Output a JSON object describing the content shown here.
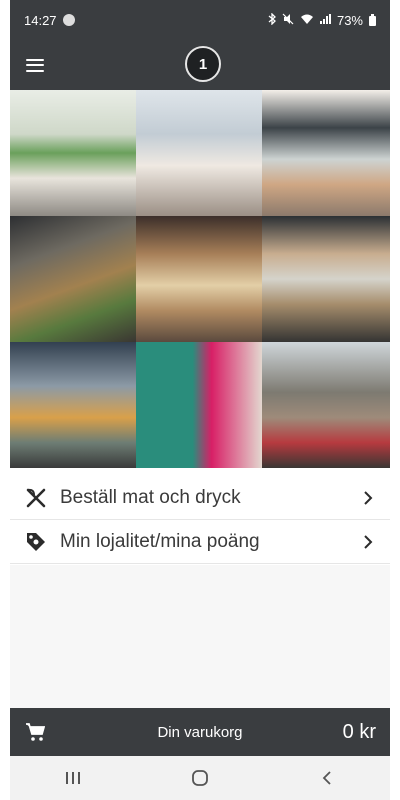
{
  "status_bar": {
    "time": "14:27",
    "battery": "73%",
    "icons": [
      "spotify-icon",
      "bluetooth-icon",
      "mute-icon",
      "wifi-icon",
      "signal-icon",
      "battery-icon"
    ]
  },
  "app_bar": {
    "logo_text": "1"
  },
  "photo_grid": {
    "tiles": [
      "photo-1",
      "photo-2",
      "photo-3",
      "photo-4",
      "photo-5",
      "photo-6",
      "photo-7",
      "photo-8",
      "photo-9"
    ]
  },
  "menu": {
    "items": [
      {
        "label": "Beställ mat och dryck",
        "icon": "cutlery-icon"
      },
      {
        "label": "Min lojalitet/mina poäng",
        "icon": "tag-icon"
      }
    ]
  },
  "cart": {
    "label": "Din varukorg",
    "total": "0 kr"
  },
  "colors": {
    "bar": "#3a3d40",
    "text": "#3a3a3a",
    "nav": "#f2f2f2"
  }
}
